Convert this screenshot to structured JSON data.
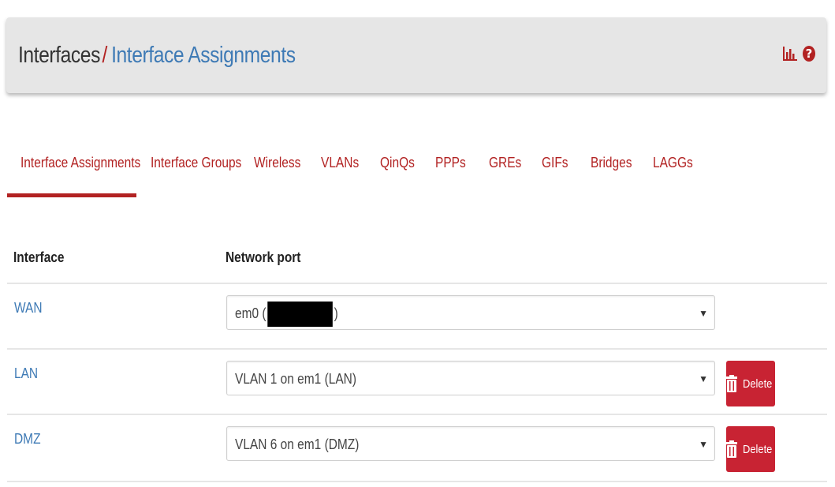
{
  "header": {
    "breadcrumb_root": "Interfaces",
    "breadcrumb_sep": "/",
    "breadcrumb_current": "Interface Assignments",
    "icons": [
      "bar-chart-icon",
      "help-icon"
    ],
    "help_glyph": "?"
  },
  "tabs": [
    {
      "label": "Interface Assignments",
      "active": true
    },
    {
      "label": "Interface Groups"
    },
    {
      "label": "Wireless"
    },
    {
      "label": "VLANs"
    },
    {
      "label": "QinQs"
    },
    {
      "label": "PPPs"
    },
    {
      "label": "GREs"
    },
    {
      "label": "GIFs"
    },
    {
      "label": "Bridges"
    },
    {
      "label": "LAGGs"
    }
  ],
  "table": {
    "headers": {
      "interface": "Interface",
      "port": "Network port"
    },
    "rows": [
      {
        "interface": "WAN",
        "port_prefix": "em0 (",
        "port_suffix": ")",
        "redacted": true,
        "delete": false
      },
      {
        "interface": "LAN",
        "port": "VLAN 1 on em1 (LAN)",
        "delete": true
      },
      {
        "interface": "DMZ",
        "port": "VLAN 6 on em1 (DMZ)",
        "delete": true
      }
    ],
    "delete_label": "Delete"
  },
  "colors": {
    "accent": "#b22222",
    "link": "#3e7ab5",
    "header_bg": "#e6e6e6",
    "danger": "#c82333"
  }
}
